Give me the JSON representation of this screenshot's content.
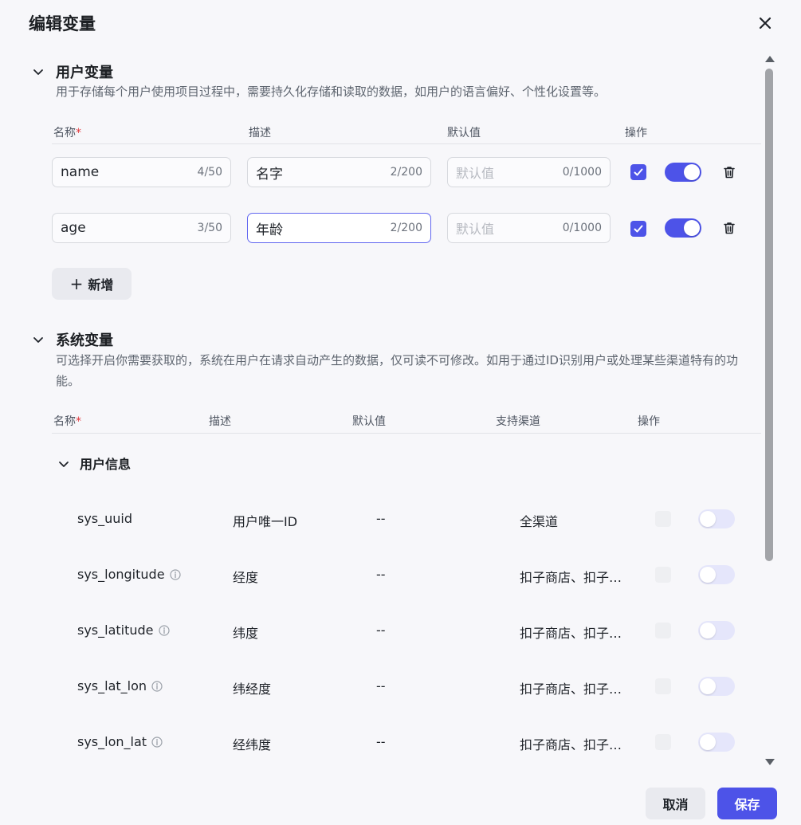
{
  "dialog": {
    "title": "编辑变量"
  },
  "user_section": {
    "title": "用户变量",
    "description": "用于存储每个用户使用项目过程中，需要持久化存储和读取的数据，如用户的语言偏好、个性化设置等。",
    "columns": {
      "name": "名称",
      "required_mark": "*",
      "desc": "描述",
      "default": "默认值",
      "ops": "操作"
    },
    "rows": [
      {
        "name": "name",
        "name_count": "4/50",
        "desc": "名字",
        "desc_count": "2/200",
        "default_placeholder": "默认值",
        "default_count": "0/1000",
        "checked": true,
        "enabled": true
      },
      {
        "name": "age",
        "name_count": "3/50",
        "desc": "年龄",
        "desc_count": "2/200",
        "default_placeholder": "默认值",
        "default_count": "0/1000",
        "checked": true,
        "enabled": true
      }
    ],
    "add_label": "新增"
  },
  "system_section": {
    "title": "系统变量",
    "description": "可选择开启你需要获取的，系统在用户在请求自动产生的数据，仅可读不可修改。如用于通过ID识别用户或处理某些渠道特有的功能。",
    "columns": {
      "name": "名称",
      "required_mark": "*",
      "desc": "描述",
      "default": "默认值",
      "channels": "支持渠道",
      "ops": "操作"
    },
    "group_title": "用户信息",
    "rows": [
      {
        "name": "sys_uuid",
        "info": false,
        "desc": "用户唯一ID",
        "default": "--",
        "channels": "全渠道",
        "enabled": false
      },
      {
        "name": "sys_longitude",
        "info": true,
        "desc": "经度",
        "default": "--",
        "channels": "扣子商店、扣子…",
        "enabled": false
      },
      {
        "name": "sys_latitude",
        "info": true,
        "desc": "纬度",
        "default": "--",
        "channels": "扣子商店、扣子…",
        "enabled": false
      },
      {
        "name": "sys_lat_lon",
        "info": true,
        "desc": "纬经度",
        "default": "--",
        "channels": "扣子商店、扣子…",
        "enabled": false
      },
      {
        "name": "sys_lon_lat",
        "info": true,
        "desc": "经纬度",
        "default": "--",
        "channels": "扣子商店、扣子…",
        "enabled": false
      }
    ]
  },
  "footer": {
    "cancel_label": "取消",
    "save_label": "保存"
  },
  "colors": {
    "accent": "#4d53e8",
    "required": "#e0373c"
  }
}
